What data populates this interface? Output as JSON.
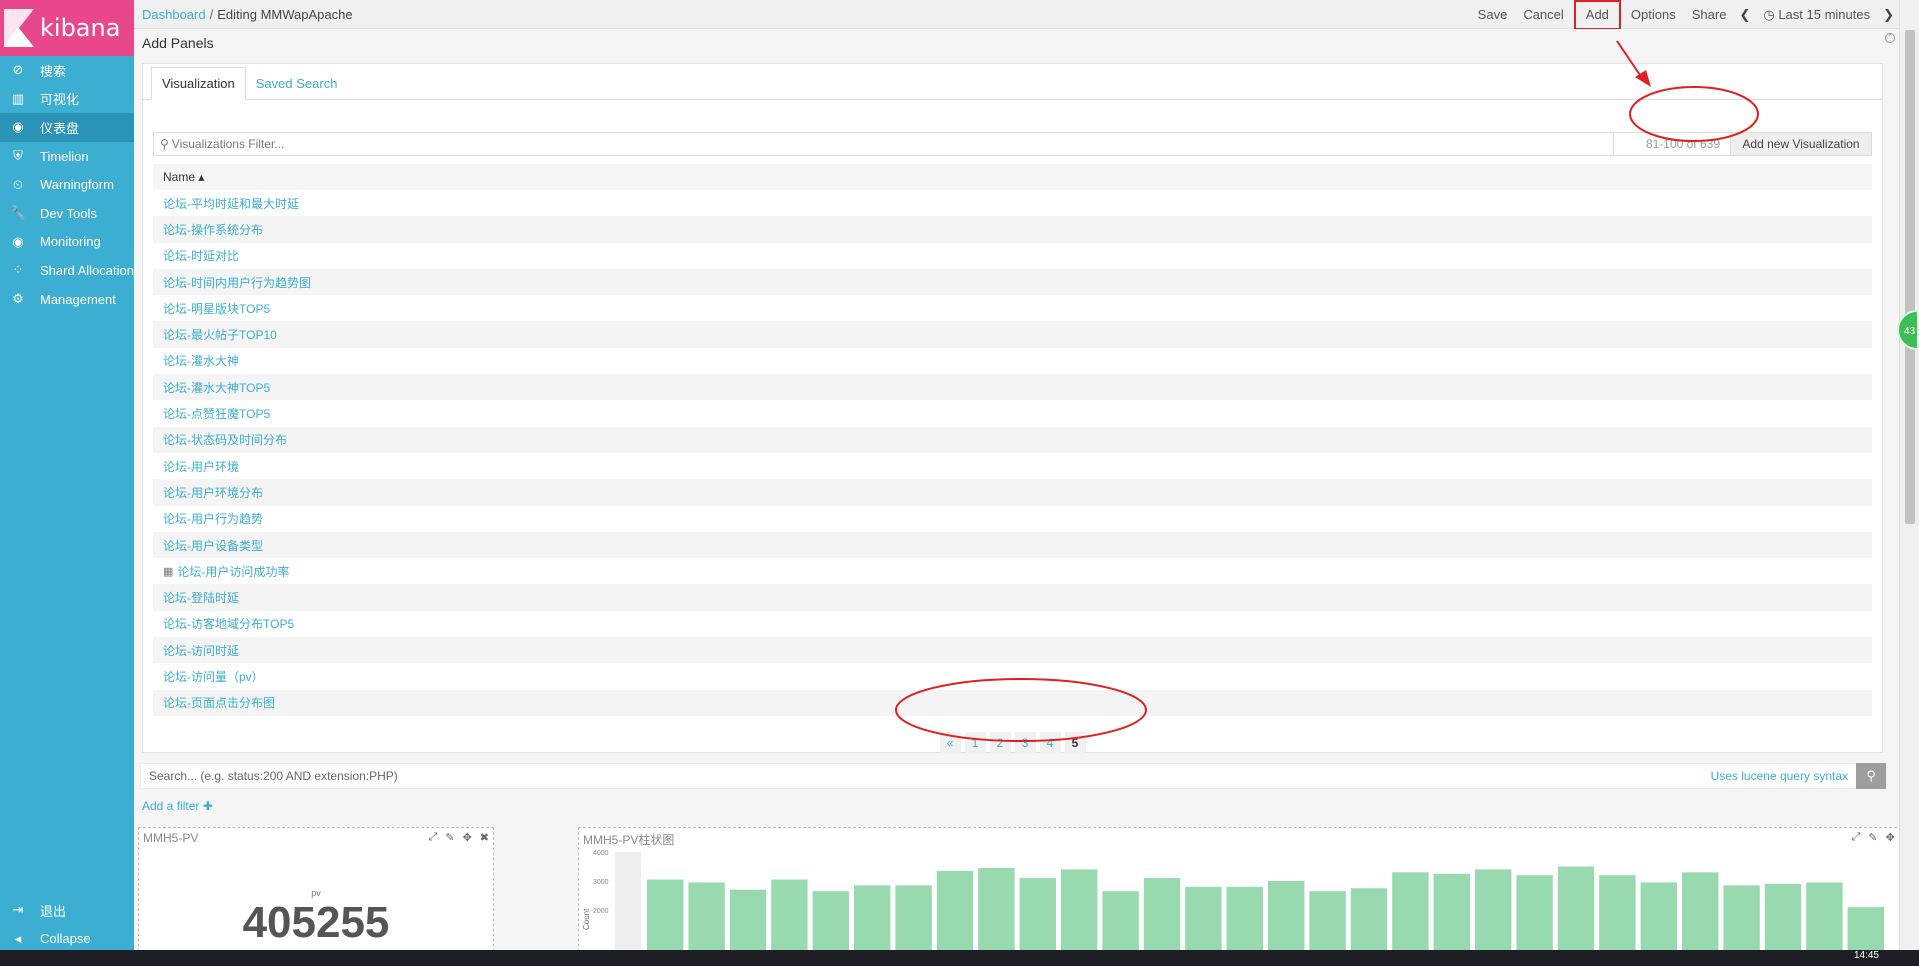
{
  "brand": {
    "name": "kibana",
    "accent": "#e8488b",
    "sidebar_color": "#3caed2"
  },
  "sidebar": {
    "items": [
      {
        "label": "搜索",
        "icon": "compass-icon"
      },
      {
        "label": "可视化",
        "icon": "bar-chart-icon"
      },
      {
        "label": "仪表盘",
        "icon": "dashboard-icon",
        "active": true
      },
      {
        "label": "Timelion",
        "icon": "shield-icon"
      },
      {
        "label": "Warningform",
        "icon": "alarm-icon"
      },
      {
        "label": "Dev Tools",
        "icon": "wrench-icon"
      },
      {
        "label": "Monitoring",
        "icon": "eye-icon"
      },
      {
        "label": "Shard Allocation",
        "icon": "shard-icon"
      },
      {
        "label": "Management",
        "icon": "gear-icon"
      }
    ],
    "bottom": [
      {
        "label": "退出",
        "icon": "logout-icon"
      },
      {
        "label": "Collapse",
        "icon": "collapse-icon"
      }
    ]
  },
  "breadcrumb": {
    "root": "Dashboard",
    "current": "Editing MMWapApache"
  },
  "top_actions": {
    "save": "Save",
    "cancel": "Cancel",
    "add": "Add",
    "options": "Options",
    "share": "Share",
    "time": "Last 15 minutes"
  },
  "add_panels": {
    "title": "Add Panels",
    "tabs": [
      "Visualization",
      "Saved Search"
    ],
    "filter_placeholder": "Visualizations Filter...",
    "count": "81-100 of 639",
    "add_new": "Add new Visualization",
    "column": "Name ▴",
    "rows": [
      "论坛-平均时延和最大时延",
      "论坛-操作系统分布",
      "论坛-时延对比",
      "论坛-时间内用户行为趋势图",
      "论坛-明星版块TOP5",
      "论坛-最火帖子TOP10",
      "论坛-灌水大神",
      "论坛-灌水大神TOP5",
      "论坛-点赞狂魔TOP5",
      "论坛-状态码及时间分布",
      "论坛-用户环境",
      "论坛-用户环境分布",
      "论坛-用户行为趋势",
      "论坛-用户设备类型",
      "论坛-用户访问成功率",
      "论坛-登陆时延",
      "论坛-访客地域分布TOP5",
      "论坛-访问时延",
      "论坛-访问量（pv）",
      "论坛-页面点击分布图"
    ],
    "pages": [
      "«",
      "1",
      "2",
      "3",
      "4",
      "5"
    ],
    "current_page": "5"
  },
  "search": {
    "placeholder": "Search... (e.g. status:200 AND extension:PHP)",
    "lucene": "Uses lucene query syntax",
    "add_filter": "Add a filter ✚"
  },
  "panels": {
    "metric": {
      "title": "MMH5-PV",
      "label": "pv",
      "value": "405255"
    },
    "bar": {
      "title": "MMH5-PV柱状图",
      "ylabel": "Count"
    }
  },
  "chart_data": {
    "type": "bar",
    "ylabel": "Count",
    "ylim": [
      0,
      4000
    ],
    "yticks": [
      "4000",
      "3000",
      "2000"
    ],
    "values": [
      3050,
      2950,
      2700,
      3050,
      2650,
      2850,
      2850,
      3350,
      3450,
      3100,
      3400,
      2650,
      3100,
      2800,
      2800,
      3000,
      2650,
      2750,
      3300,
      3250,
      3400,
      3200,
      3500,
      3200,
      2950,
      3300,
      2850,
      2900,
      2950,
      2100
    ],
    "color": "#98d9b0"
  },
  "clock": "14:45"
}
